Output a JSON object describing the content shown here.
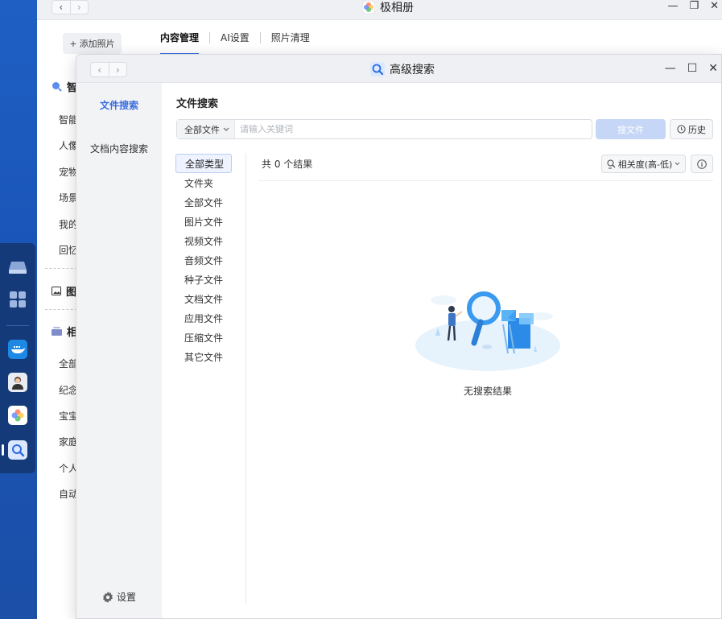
{
  "back_window": {
    "title": "极相册",
    "add_photo_label": "添加照片",
    "tabs": [
      "内容管理",
      "AI设置",
      "照片清理"
    ],
    "active_tab": 0,
    "sidebar": {
      "section_smart": "智",
      "smart_items": [
        "智能",
        "人像",
        "宠物",
        "场景",
        "我的",
        "回忆"
      ],
      "section_gallery": "图",
      "section_album": "相",
      "album_items": [
        "全部",
        "纪念",
        "宝宝",
        "家庭",
        "个人",
        "自动"
      ]
    }
  },
  "front_window": {
    "title": "高级搜索",
    "sidebar": {
      "items": [
        "文件搜索",
        "文档内容搜索"
      ],
      "active_index": 0,
      "settings_label": "设置"
    },
    "main": {
      "heading": "文件搜索",
      "scope_value": "全部文件",
      "search_placeholder": "请输入关键词",
      "search_button": "搜文件",
      "history_button": "历史",
      "file_types": [
        "全部类型",
        "文件夹",
        "全部文件",
        "图片文件",
        "视频文件",
        "音频文件",
        "种子文件",
        "文档文件",
        "应用文件",
        "压缩文件",
        "其它文件"
      ],
      "active_type": 0,
      "result_count_text": "共 0 个结果",
      "sort_label": "相关度(高-低)",
      "empty_text": "无搜索结果"
    }
  },
  "colors": {
    "accent": "#3a6de0",
    "search_button_disabled": "#c6d6f6",
    "dock_bg": "#143a7a",
    "desktop_bg": "#1f5fc4"
  },
  "icons": {
    "dock": [
      "drive-icon",
      "apps-grid-icon",
      "docker-icon",
      "user-avatar-icon",
      "photos-app-icon",
      "search-app-icon"
    ]
  }
}
